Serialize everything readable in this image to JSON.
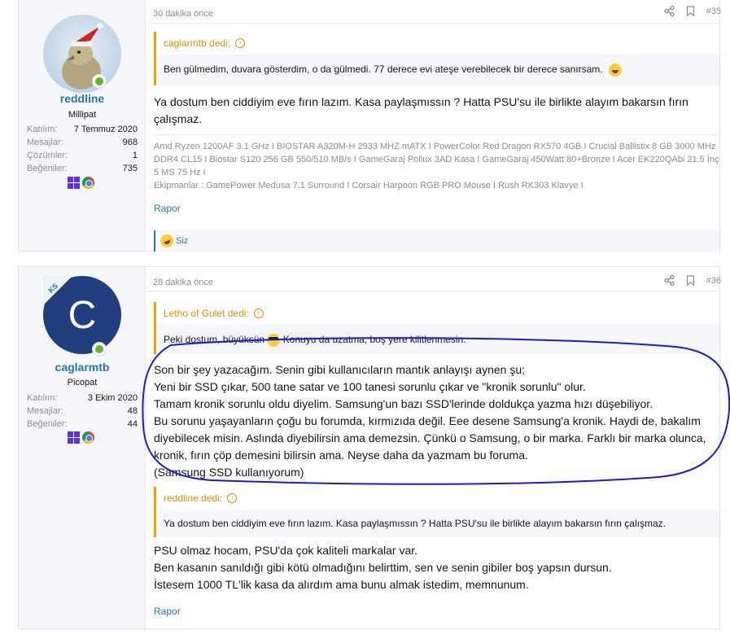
{
  "posts": [
    {
      "user": {
        "name": "reddline",
        "title": "Millipat",
        "stats": [
          {
            "label": "Katılım:",
            "value": "7 Temmuz 2020"
          },
          {
            "label": "Mesajlar:",
            "value": "968"
          },
          {
            "label": "Çözümler:",
            "value": "1"
          },
          {
            "label": "Beğeniler:",
            "value": "735"
          }
        ]
      },
      "time": "30 dakika önce",
      "number": "#35",
      "quote": {
        "author": "caglarmtb dedi:",
        "text": "Ben gülmedim, duvara gösterdim, o da gülmedi. 77 derece evi ateşe verebilecek bir derece sanırsam."
      },
      "body": "Ya dostum ben ciddiyim eve fırın lazım. Kasa paylaşmıssın ? Hatta PSU'su ile birlikte alayım bakarsın fırın çalışmaz.",
      "signature": [
        "Amd Ryzen 1200AF 3.1 GHz I BİOSTAR A320M-H 2933 MHZ mATX I PowerColor Red Dragon RX570 4GB I Crucial Ballistix 8 GB 3000 MHz DDR4 CL15 I Biostar S120 256 GB 550/510 MB/s I GameGaraj Pollux 3AD Kasa I GameGaraj 450Watt 80+Bronze I Acer EK220QAbi 21.5 İnç 5 MS 75 Hz I",
        "Ekipmanlar : GamePower Medusa 7.1 Surround I Corsair Harpoon RGB PRO Mouse I Rush RK303 Klavye I"
      ],
      "report": "Rapor",
      "reaction": "Siz"
    },
    {
      "user": {
        "name": "caglarmtb",
        "title": "Picopat",
        "avatar_letter": "C",
        "badge": "KS",
        "stats": [
          {
            "label": "Katılım:",
            "value": "3 Ekim 2020"
          },
          {
            "label": "Mesajlar:",
            "value": "48"
          },
          {
            "label": "Beğeniler:",
            "value": "44"
          }
        ]
      },
      "time": "28 dakika önce",
      "number": "#36",
      "quote1": {
        "author": "Letho of Gulet dedi:",
        "text_before": "Peki dostum, büyüksün",
        "text_after": "Konuyu da uzatma, boş yere kilitlenmesin."
      },
      "body1": [
        "Son bir şey yazacağım. Senin gibi kullanıcıların mantık anlayışı aynen şu;",
        "Yeni bir SSD çıkar, 500 tane satar ve 100 tanesi sorunlu çıkar ve \"kronik sorunlu\" olur.",
        "Tamam kronik sorunlu oldu diyelim. Samsung'un bazı SSD'lerinde doldukça yazma hızı düşebiliyor.",
        "Bu sorunu yaşayanların çoğu bu forumda, kırmızıda değil. Eee desene Samsung'a kronik. Haydi de, bakalım diyebilecek misin. Aslında diyebilirsin ama demezsin. Çünkü o Samsung, o bir marka. Farklı bir marka olunca, kronik, fırın çöp demesini bilirsin ama. Neyse daha da yazmam bu foruma.",
        "(Samsung SSD kullanıyorum)"
      ],
      "quote2": {
        "author": "reddline dedi:",
        "text": "Ya dostum ben ciddiyim eve fırın lazım. Kasa paylaşmıssın ? Hatta PSU'su ile birlikte alayım bakarsın fırın çalışmaz."
      },
      "body2": [
        "PSU olmaz hocam, PSU'da çok kaliteli markalar var.",
        "Ben kasanın sanıldığı gibi kötü olmadığını belirttim, sen ve senin gibiler boş yapsın dursun.",
        "İstesem 1000 TL'lik kasa da alırdım ama bunu almak istedim, memnunum."
      ],
      "report": "Rapor"
    }
  ],
  "colors": {
    "link": "#2577b1",
    "quote_accent": "#df8c00",
    "muted": "#8c8c8c",
    "annotation": "#1a1ad6"
  }
}
